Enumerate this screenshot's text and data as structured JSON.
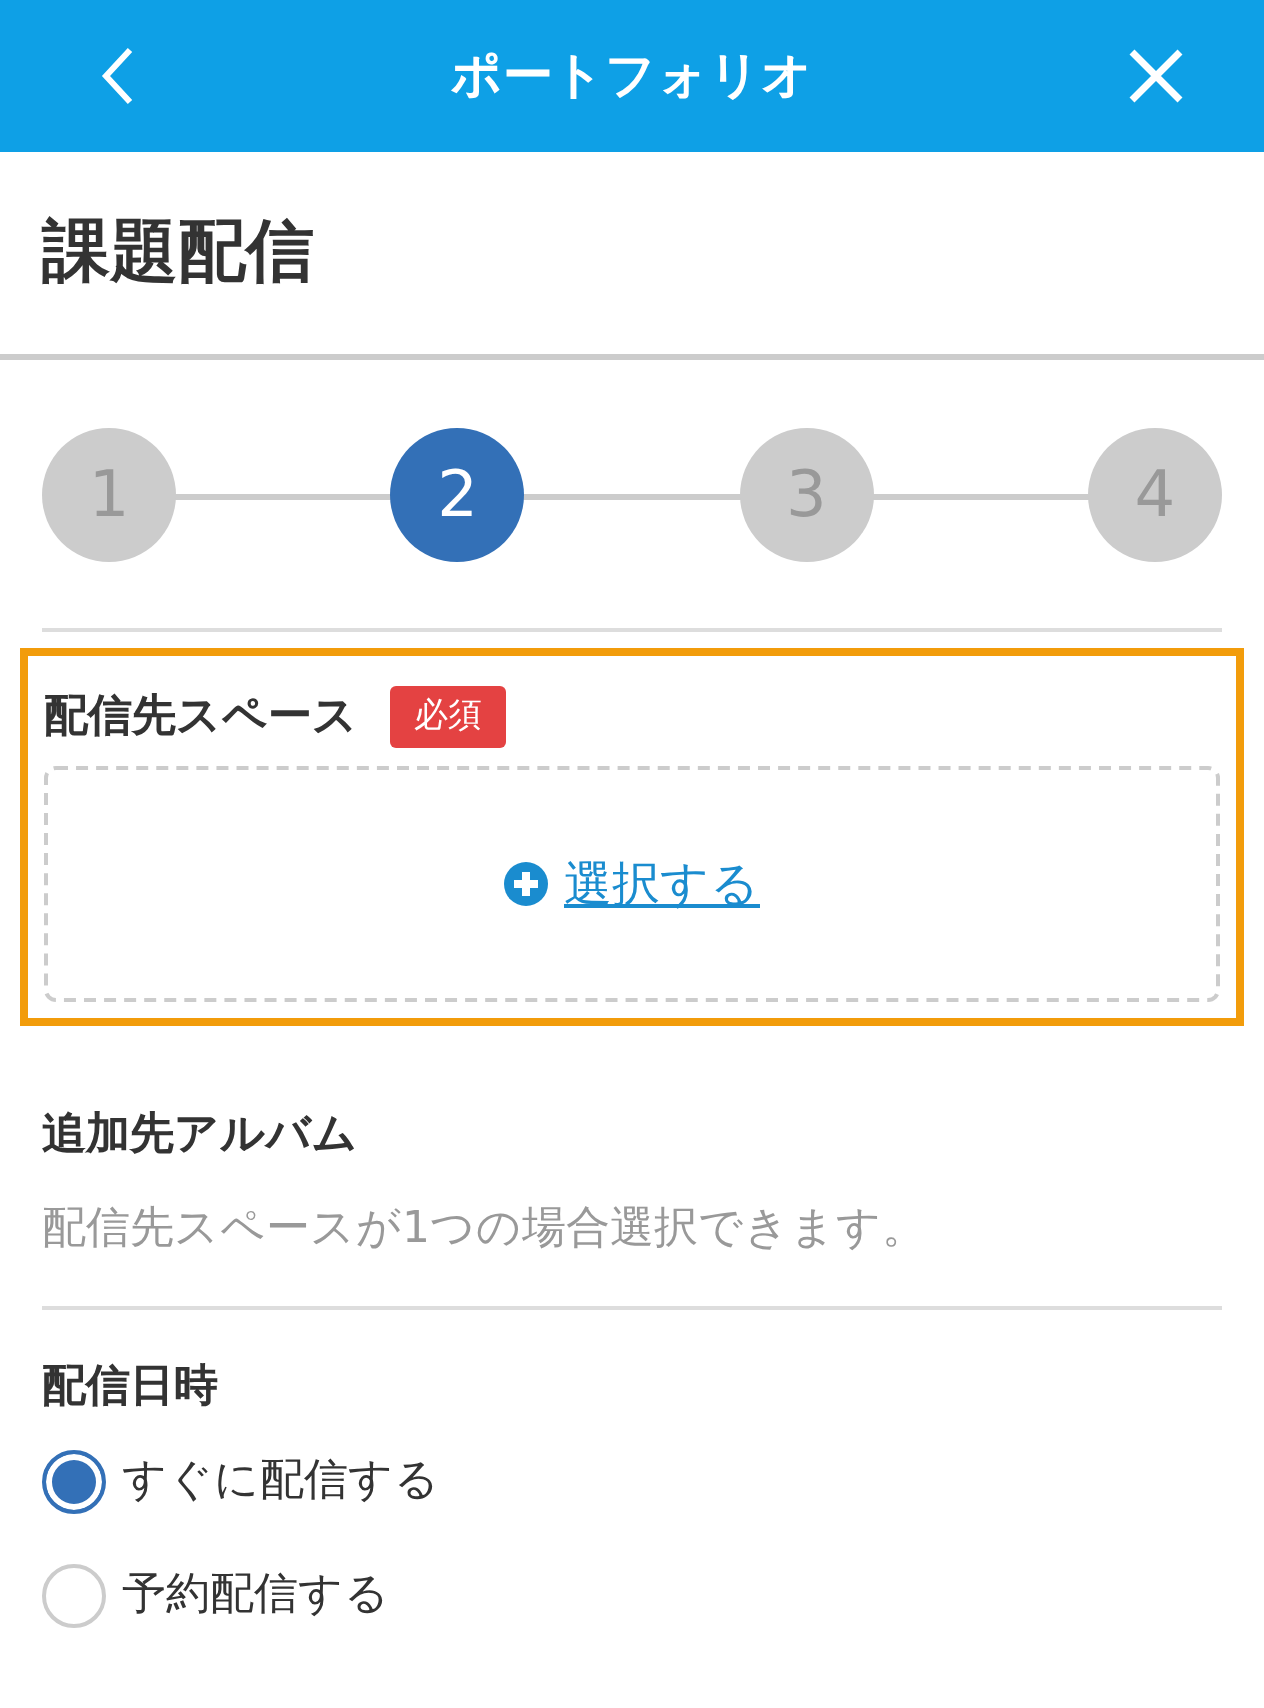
{
  "header": {
    "title": "ポートフォリオ"
  },
  "page_title": "課題配信",
  "steps": [
    {
      "label": "1",
      "selected": false
    },
    {
      "label": "2",
      "selected": true
    },
    {
      "label": "3",
      "selected": false
    },
    {
      "label": "4",
      "selected": false
    }
  ],
  "sections": [
    {
      "kind": "picker",
      "label": "配信先スペース",
      "badge": "必須",
      "highlighted": true,
      "action": "選択する"
    },
    {
      "kind": "note",
      "label": "追加先アルバム",
      "hint": "配信先スペースが1つの場合選択できます。"
    },
    {
      "kind": "radio",
      "label": "配信日時",
      "options": [
        {
          "label": "すぐに配信する",
          "selected": true
        },
        {
          "label": "予約配信する",
          "selected": false
        }
      ]
    }
  ]
}
